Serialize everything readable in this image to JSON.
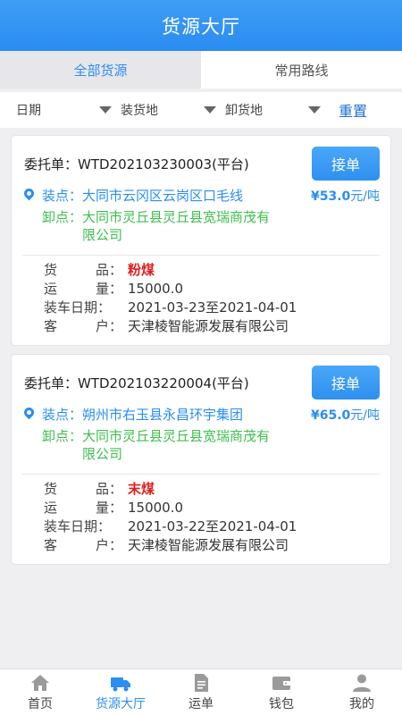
{
  "header": {
    "title": "货源大厅"
  },
  "tabs": [
    {
      "label": "全部货源",
      "active": true
    },
    {
      "label": "常用路线",
      "active": false
    }
  ],
  "filters": {
    "date_label": "日期",
    "load_label": "装货地",
    "unload_label": "卸货地",
    "reset_label": "重置"
  },
  "orders": [
    {
      "order_text": "委托单：WTD202103230003(平台)",
      "accept_label": "接单",
      "load_text": "装点：大同市云冈区云岗区口毛线",
      "price_value": "¥53.0",
      "price_unit": "元/吨",
      "unload_label": "卸点：",
      "unload_text": "大同市灵丘县灵丘县宽瑞商茂有限公司",
      "goods_k1": "货",
      "goods_k2": "品：",
      "goods_v": "粉煤",
      "qty_k1": "运",
      "qty_k2": "量：",
      "qty_v": "15000.0",
      "date_k": "装车日期：",
      "date_v": "2021-03-23至2021-04-01",
      "cust_k1": "客",
      "cust_k2": "户：",
      "cust_v": "天津棱智能源发展有限公司"
    },
    {
      "order_text": "委托单：WTD202103220004(平台)",
      "accept_label": "接单",
      "load_text": "装点：朔州市右玉县永昌环宇集团",
      "price_value": "¥65.0",
      "price_unit": "元/吨",
      "unload_label": "卸点：",
      "unload_text": "大同市灵丘县灵丘县宽瑞商茂有限公司",
      "goods_k1": "货",
      "goods_k2": "品：",
      "goods_v": "末煤",
      "qty_k1": "运",
      "qty_k2": "量：",
      "qty_v": "15000.0",
      "date_k": "装车日期：",
      "date_v": "2021-03-22至2021-04-01",
      "cust_k1": "客",
      "cust_k2": "户：",
      "cust_v": "天津棱智能源发展有限公司"
    }
  ],
  "tabbar": [
    {
      "label": "首页",
      "icon": "home-icon"
    },
    {
      "label": "货源大厅",
      "icon": "truck-icon",
      "active": true
    },
    {
      "label": "运单",
      "icon": "document-icon"
    },
    {
      "label": "钱包",
      "icon": "wallet-icon"
    },
    {
      "label": "我的",
      "icon": "user-icon"
    }
  ],
  "colors": {
    "primary": "#2b8ef0",
    "green": "#3fbf4f",
    "red": "#e02020"
  }
}
